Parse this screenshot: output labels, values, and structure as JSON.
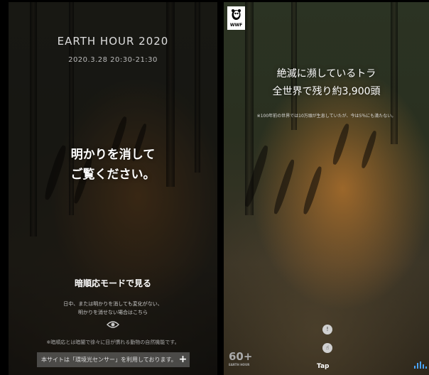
{
  "left_panel": {
    "title": "EARTH HOUR 2020",
    "date": "2020.3.28 20:30-21:30",
    "message_line1": "明かりを消して",
    "message_line2": "ご覧ください。",
    "mode_button": "暗順応モードで見る",
    "mode_desc_line1": "日中、または明かりを消しても変化がない、",
    "mode_desc_line2": "明かりを消せない場合はこちら",
    "eye_icon": "eye-icon",
    "note": "※暗順応とは暗闇で徐々に目が慣れる動物の自然機能です。",
    "footer_text": "本サイトは「環境光センサー」を利用しております。",
    "footer_button": "+"
  },
  "right_panel": {
    "logo_text": "WWF",
    "headline_line1": "絶滅に瀕しているトラ",
    "headline_line2": "全世界で残り約3,900頭",
    "subnote": "※100年前の世界では10万頭が生息していたが、今は5％にも満たない。",
    "info_icon": "info-icon",
    "tap_icon": "hand-icon",
    "tap_label": "Tap",
    "earth_hour_logo": "60+",
    "earth_hour_caption": "EARTH HOUR",
    "audio_icon": "audio-bars-icon"
  }
}
